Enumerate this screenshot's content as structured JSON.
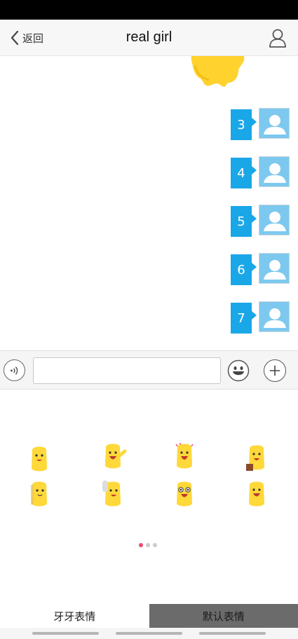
{
  "header": {
    "back_label": "返回",
    "title": "real girl"
  },
  "messages": [
    {
      "text": "3"
    },
    {
      "text": "4"
    },
    {
      "text": "5"
    },
    {
      "text": "6"
    },
    {
      "text": "7"
    }
  ],
  "input": {
    "value": "",
    "placeholder": ""
  },
  "sticker_panel": {
    "page_count": 3,
    "active_page": 1
  },
  "tabs": [
    {
      "label": "牙牙表情",
      "active": true
    },
    {
      "label": "默认表情",
      "active": false
    }
  ],
  "colors": {
    "bubble": "#1aa7e8",
    "avatar": "#7dc8ef",
    "sticker_yellow": "#ffd83a",
    "active_dot": "#ef4b6f"
  }
}
